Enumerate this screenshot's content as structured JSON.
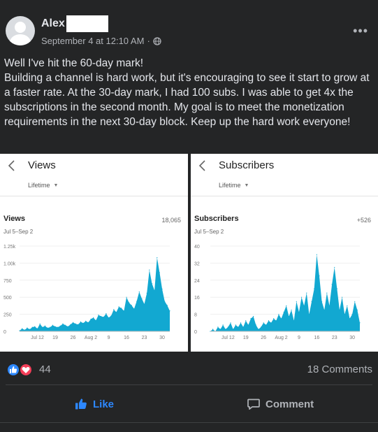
{
  "post": {
    "author": "Alex",
    "timestamp": "September 4 at 12:10 AM",
    "meta_separator": "·",
    "privacy_icon": "globe-icon",
    "more_icon": "more-horizontal-icon",
    "more_label": "•••",
    "text_lines": [
      "Well I've hit the 60-day mark!",
      "Building a channel is hard work, but it's encouraging to see it start to grow at a faster rate. At the 30-day mark, I had 100 subs. I was able to get 4x the subscriptions in the second month. My goal is to meet the monetization requirements in the next 30-day block. Keep up the hard work everyone!"
    ]
  },
  "chart_data": [
    {
      "type": "area",
      "header_title": "Views",
      "period": "Lifetime",
      "title": "Views",
      "total": "18,065",
      "date_range": "Jul 5–Sep 2",
      "color": "#12a8d1",
      "ylim": [
        0,
        1250
      ],
      "yticks": [
        "1.25k",
        "1.00k",
        "750",
        "500",
        "250",
        "0"
      ],
      "ytick_values": [
        1250,
        1000,
        750,
        500,
        250,
        0
      ],
      "xticks": [
        "Jul 12",
        "19",
        "26",
        "Aug 2",
        "9",
        "16",
        "23",
        "30"
      ],
      "xtick_day_index": [
        7,
        14,
        21,
        28,
        35,
        42,
        49,
        56
      ],
      "x": [
        "Jul 5",
        "Jul 6",
        "Jul 7",
        "Jul 8",
        "Jul 9",
        "Jul 10",
        "Jul 11",
        "Jul 12",
        "Jul 13",
        "Jul 14",
        "Jul 15",
        "Jul 16",
        "Jul 17",
        "Jul 18",
        "Jul 19",
        "Jul 20",
        "Jul 21",
        "Jul 22",
        "Jul 23",
        "Jul 24",
        "Jul 25",
        "Jul 26",
        "Jul 27",
        "Jul 28",
        "Jul 29",
        "Jul 30",
        "Jul 31",
        "Aug 1",
        "Aug 2",
        "Aug 3",
        "Aug 4",
        "Aug 5",
        "Aug 6",
        "Aug 7",
        "Aug 8",
        "Aug 9",
        "Aug 10",
        "Aug 11",
        "Aug 12",
        "Aug 13",
        "Aug 14",
        "Aug 15",
        "Aug 16",
        "Aug 17",
        "Aug 18",
        "Aug 19",
        "Aug 20",
        "Aug 21",
        "Aug 22",
        "Aug 23",
        "Aug 24",
        "Aug 25",
        "Aug 26",
        "Aug 27",
        "Aug 28",
        "Aug 29",
        "Aug 30",
        "Aug 31",
        "Sep 1",
        "Sep 2"
      ],
      "values": [
        10,
        40,
        20,
        50,
        30,
        60,
        70,
        40,
        110,
        60,
        80,
        50,
        60,
        90,
        70,
        60,
        80,
        110,
        90,
        70,
        100,
        130,
        110,
        100,
        140,
        120,
        150,
        130,
        180,
        200,
        160,
        240,
        220,
        210,
        260,
        200,
        230,
        320,
        280,
        360,
        340,
        300,
        500,
        420,
        380,
        330,
        440,
        580,
        480,
        400,
        560,
        900,
        700,
        600,
        1080,
        860,
        620,
        440,
        380,
        300
      ]
    },
    {
      "type": "area",
      "header_title": "Subscribers",
      "period": "Lifetime",
      "title": "Subscribers",
      "total": "+526",
      "date_range": "Jul 5–Sep 2",
      "color": "#12a8d1",
      "ylim": [
        0,
        40
      ],
      "yticks": [
        "40",
        "32",
        "24",
        "16",
        "8",
        "0"
      ],
      "ytick_values": [
        40,
        32,
        24,
        16,
        8,
        0
      ],
      "xticks": [
        "Jul 12",
        "19",
        "26",
        "Aug 2",
        "9",
        "16",
        "23",
        "30"
      ],
      "xtick_day_index": [
        7,
        14,
        21,
        28,
        35,
        42,
        49,
        56
      ],
      "x": [
        "Jul 5",
        "Jul 6",
        "Jul 7",
        "Jul 8",
        "Jul 9",
        "Jul 10",
        "Jul 11",
        "Jul 12",
        "Jul 13",
        "Jul 14",
        "Jul 15",
        "Jul 16",
        "Jul 17",
        "Jul 18",
        "Jul 19",
        "Jul 20",
        "Jul 21",
        "Jul 22",
        "Jul 23",
        "Jul 24",
        "Jul 25",
        "Jul 26",
        "Jul 27",
        "Jul 28",
        "Jul 29",
        "Jul 30",
        "Jul 31",
        "Aug 1",
        "Aug 2",
        "Aug 3",
        "Aug 4",
        "Aug 5",
        "Aug 6",
        "Aug 7",
        "Aug 8",
        "Aug 9",
        "Aug 10",
        "Aug 11",
        "Aug 12",
        "Aug 13",
        "Aug 14",
        "Aug 15",
        "Aug 16",
        "Aug 17",
        "Aug 18",
        "Aug 19",
        "Aug 20",
        "Aug 21",
        "Aug 22",
        "Aug 23",
        "Aug 24",
        "Aug 25",
        "Aug 26",
        "Aug 27",
        "Aug 28",
        "Aug 29",
        "Aug 30",
        "Aug 31",
        "Sep 1",
        "Sep 2"
      ],
      "values": [
        0,
        1,
        0,
        2,
        1,
        3,
        1,
        2,
        4,
        1,
        3,
        2,
        4,
        2,
        5,
        3,
        6,
        7,
        3,
        1,
        2,
        4,
        3,
        5,
        4,
        6,
        5,
        8,
        6,
        9,
        12,
        7,
        10,
        5,
        14,
        9,
        16,
        12,
        18,
        8,
        14,
        20,
        36,
        26,
        14,
        10,
        18,
        12,
        22,
        30,
        20,
        10,
        16,
        8,
        12,
        6,
        8,
        14,
        10,
        4
      ]
    }
  ],
  "reactions": {
    "like_icon": "like-reaction-icon",
    "love_icon": "love-reaction-icon",
    "count": "44",
    "comments": "18 Comments"
  },
  "actions": {
    "like_label": "Like",
    "like_icon": "thumbs-up-icon",
    "comment_label": "Comment",
    "comment_icon": "comment-bubble-icon"
  }
}
